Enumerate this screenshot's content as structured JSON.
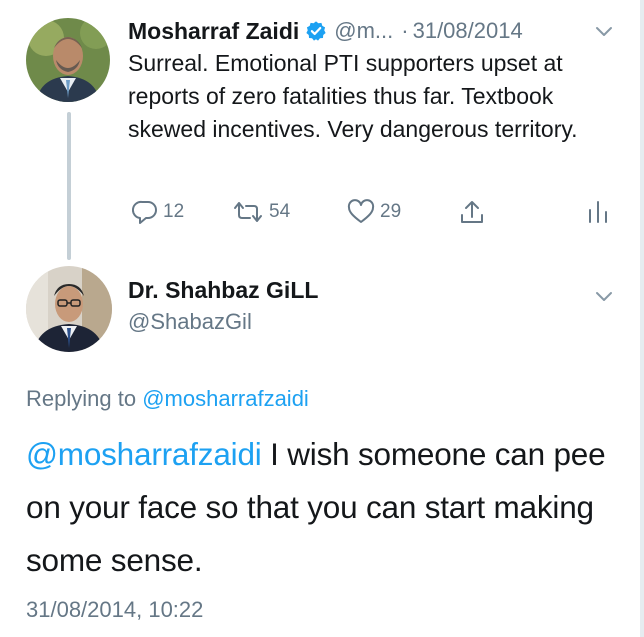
{
  "colors": {
    "link": "#1da1f2",
    "secondary_text": "#657786",
    "thread_line": "#c4cfd6",
    "verified_badge": "#1da1f2"
  },
  "tweet1": {
    "name": "Mosharraf Zaidi",
    "handle": "@m...",
    "separator": "·",
    "date": "31/08/2014",
    "text": "Surreal. Emotional PTI supporters upset at reports of zero fatalities thus far. Textbook skewed incentives. Very dangerous territory.",
    "actions": {
      "replies": "12",
      "retweets": "54",
      "likes": "29"
    },
    "icons": [
      "reply-icon",
      "retweet-icon",
      "like-icon",
      "share-icon",
      "analytics-icon",
      "chevron-down-icon",
      "verified-icon"
    ]
  },
  "tweet2": {
    "name": "Dr. Shahbaz GiLL",
    "handle": "@ShabazGil",
    "replying_prefix": "Replying to",
    "replying_to": "@mosharrafzaidi",
    "mention": "@mosharrafzaidi",
    "text": " I wish someone can pee on your face so that you can start making some sense.",
    "timestamp": "31/08/2014, 10:22"
  }
}
